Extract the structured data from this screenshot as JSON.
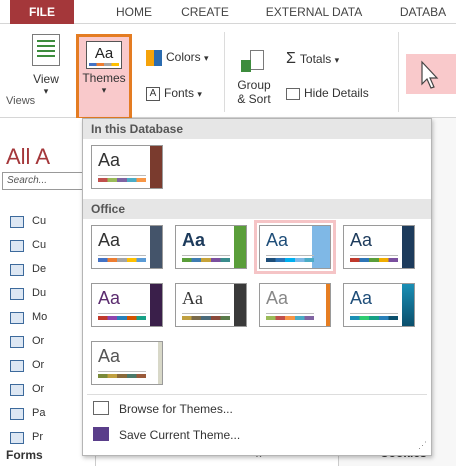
{
  "ribbon": {
    "tabs": [
      "FILE",
      "HOME",
      "CREATE",
      "EXTERNAL DATA",
      "DATABA"
    ],
    "views_group_label": "Views",
    "view_label": "View",
    "themes_label": "Themes",
    "colors_label": "Colors",
    "fonts_label": "Fonts",
    "group_sort_label_1": "Group",
    "group_sort_label_2": "& Sort",
    "totals_label": "Totals",
    "hide_details_label": "Hide Details",
    "dropdown_arrow": "▾"
  },
  "nav_pane": {
    "title": "All A",
    "search_placeholder": "Search...",
    "items": [
      "Cu",
      "Cu",
      "De",
      "Du",
      "Mo",
      "Or",
      "Or",
      "Or",
      "Pa",
      "Pr"
    ],
    "forms_header": "Forms"
  },
  "gallery": {
    "section_this_db": "In this Database",
    "section_office": "Office",
    "thumb_text": "Aa",
    "menu": {
      "browse": "Browse for Themes...",
      "save": "Save Current Theme..."
    }
  },
  "background": {
    "cookies_label": "Cookies",
    "close_x": "x"
  },
  "colors": {
    "file_tab": "#a4373a",
    "highlight": "#f9c9cb",
    "themes_border": "#e47c22"
  }
}
